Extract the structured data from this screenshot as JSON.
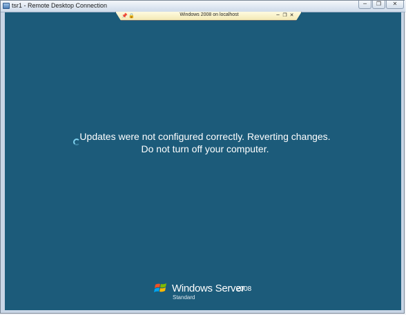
{
  "window": {
    "title": "tsr1 - Remote Desktop Connection",
    "minimize_glyph": "─",
    "restore_glyph": "❐",
    "close_glyph": "✕"
  },
  "connection_bar": {
    "title": "Windows 2008 on localhost",
    "pin_glyph": "📌",
    "lock_glyph": "🔒",
    "minimize_glyph": "─",
    "restore_glyph": "❐",
    "close_glyph": "✕"
  },
  "remote_screen": {
    "background_color": "#1c5b7a",
    "message_line1": "Updates were not configured correctly.  Reverting changes.",
    "message_line2": "Do not turn off your computer.",
    "brand_name": "Windows Server",
    "brand_version": "2008",
    "edition": "Standard"
  }
}
